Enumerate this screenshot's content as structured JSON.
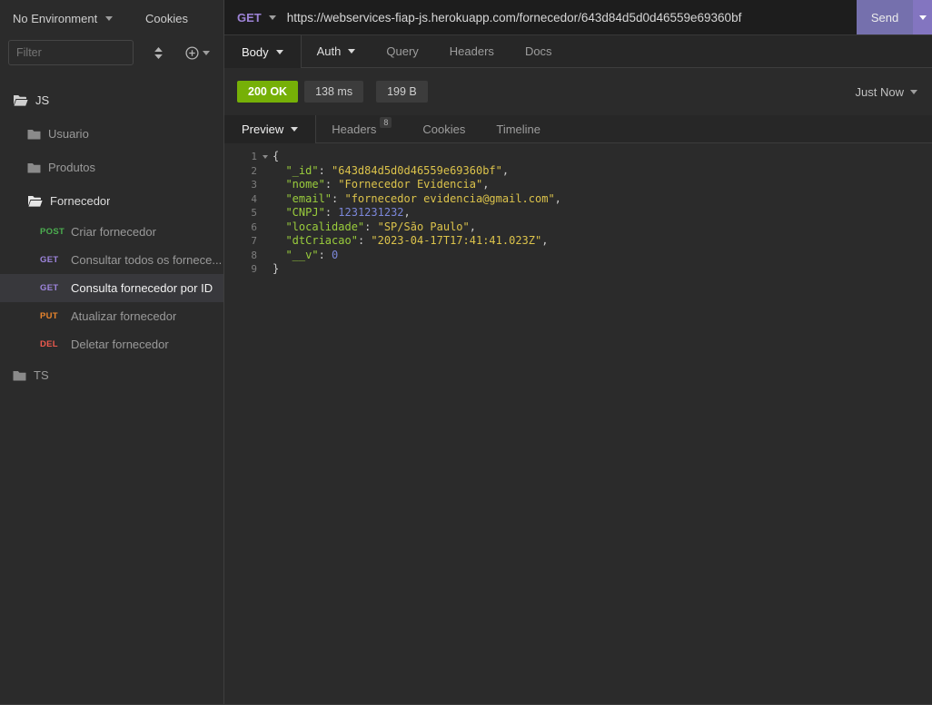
{
  "colors": {
    "accent_purple": "#7570ad",
    "status_green": "#76b007",
    "method_get": "#9e85dd",
    "method_post": "#4caf50",
    "method_put": "#e8852d",
    "method_del": "#ee5a4e",
    "json_key": "#9acd3c",
    "json_string": "#dcc34b",
    "json_number": "#7b87d9"
  },
  "topbar": {
    "environment_label": "No Environment",
    "cookies_label": "Cookies"
  },
  "sidebar": {
    "filter_placeholder": "Filter",
    "tree": [
      {
        "kind": "folder",
        "label": "JS",
        "state": "open",
        "level": 0
      },
      {
        "kind": "folder",
        "label": "Usuario",
        "state": "closed",
        "level": 1
      },
      {
        "kind": "folder",
        "label": "Produtos",
        "state": "closed",
        "level": 1
      },
      {
        "kind": "folder",
        "label": "Fornecedor",
        "state": "open",
        "level": 1
      },
      {
        "kind": "request",
        "method": "POST",
        "label": "Criar fornecedor",
        "selected": false
      },
      {
        "kind": "request",
        "method": "GET",
        "label": "Consultar todos os fornece...",
        "selected": false
      },
      {
        "kind": "request",
        "method": "GET",
        "label": "Consulta fornecedor por ID",
        "selected": true
      },
      {
        "kind": "request",
        "method": "PUT",
        "label": "Atualizar fornecedor",
        "selected": false
      },
      {
        "kind": "request",
        "method": "DEL",
        "label": "Deletar fornecedor",
        "selected": false
      },
      {
        "kind": "folder",
        "label": "TS",
        "state": "closed",
        "level": 0
      }
    ]
  },
  "request": {
    "method": "GET",
    "url": "https://webservices-fiap-js.herokuapp.com/fornecedor/643d84d5d0d46559e69360bf",
    "send_label": "Send",
    "tabs": [
      {
        "label": "Body",
        "dropdown": true,
        "active": true
      },
      {
        "label": "Auth",
        "dropdown": true,
        "active": false
      },
      {
        "label": "Query",
        "dropdown": false,
        "active": false
      },
      {
        "label": "Headers",
        "dropdown": false,
        "active": false
      },
      {
        "label": "Docs",
        "dropdown": false,
        "active": false
      }
    ]
  },
  "response": {
    "status_badge": "200 OK",
    "time_badge": "138 ms",
    "size_badge": "199 B",
    "timestamp_label": "Just Now",
    "tabs": [
      {
        "label": "Preview",
        "dropdown": true,
        "active": true
      },
      {
        "label": "Headers",
        "badge": "8",
        "dropdown": false,
        "active": false
      },
      {
        "label": "Cookies",
        "dropdown": false,
        "active": false
      },
      {
        "label": "Timeline",
        "dropdown": false,
        "active": false
      }
    ],
    "body_lines": [
      {
        "num": 1,
        "fold": true,
        "indent": 0,
        "tokens": [
          [
            "punc",
            "{"
          ]
        ]
      },
      {
        "num": 2,
        "fold": false,
        "indent": 2,
        "tokens": [
          [
            "key",
            "\"_id\""
          ],
          [
            "punc",
            ": "
          ],
          [
            "str",
            "\"643d84d5d0d46559e69360bf\""
          ],
          [
            "punc",
            ","
          ]
        ]
      },
      {
        "num": 3,
        "fold": false,
        "indent": 2,
        "tokens": [
          [
            "key",
            "\"nome\""
          ],
          [
            "punc",
            ": "
          ],
          [
            "str",
            "\"Fornecedor Evidencia\""
          ],
          [
            "punc",
            ","
          ]
        ]
      },
      {
        "num": 4,
        "fold": false,
        "indent": 2,
        "tokens": [
          [
            "key",
            "\"email\""
          ],
          [
            "punc",
            ": "
          ],
          [
            "str",
            "\"fornecedor evidencia@gmail.com\""
          ],
          [
            "punc",
            ","
          ]
        ]
      },
      {
        "num": 5,
        "fold": false,
        "indent": 2,
        "tokens": [
          [
            "key",
            "\"CNPJ\""
          ],
          [
            "punc",
            ": "
          ],
          [
            "num",
            "1231231232"
          ],
          [
            "punc",
            ","
          ]
        ]
      },
      {
        "num": 6,
        "fold": false,
        "indent": 2,
        "tokens": [
          [
            "key",
            "\"localidade\""
          ],
          [
            "punc",
            ": "
          ],
          [
            "str",
            "\"SP/São Paulo\""
          ],
          [
            "punc",
            ","
          ]
        ]
      },
      {
        "num": 7,
        "fold": false,
        "indent": 2,
        "tokens": [
          [
            "key",
            "\"dtCriacao\""
          ],
          [
            "punc",
            ": "
          ],
          [
            "str",
            "\"2023-04-17T17:41:41.023Z\""
          ],
          [
            "punc",
            ","
          ]
        ]
      },
      {
        "num": 8,
        "fold": false,
        "indent": 2,
        "tokens": [
          [
            "key",
            "\"__v\""
          ],
          [
            "punc",
            ": "
          ],
          [
            "num",
            "0"
          ]
        ]
      },
      {
        "num": 9,
        "fold": false,
        "indent": 0,
        "tokens": [
          [
            "punc",
            "}"
          ]
        ]
      }
    ]
  }
}
